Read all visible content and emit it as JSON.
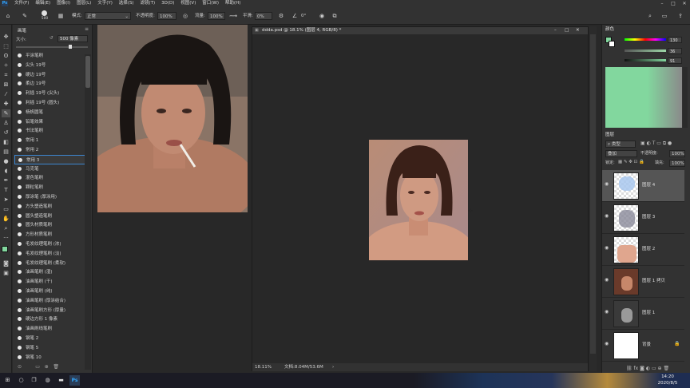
{
  "menubar": {
    "app_icon": "Ps",
    "items": [
      "文件(F)",
      "编辑(E)",
      "图像(I)",
      "图层(L)",
      "文字(Y)",
      "选择(S)",
      "滤镜(T)",
      "3D(D)",
      "视图(V)",
      "窗口(W)",
      "帮助(H)"
    ]
  },
  "optionsbar": {
    "brush_size": "500",
    "mode_label": "模式:",
    "mode_value": "正常",
    "opacity_label": "不透明度:",
    "opacity_value": "100%",
    "flow_label": "流量:",
    "flow_value": "100%",
    "smooth_label": "平滑:",
    "smooth_value": "0%",
    "angle_value": "0°"
  },
  "brushpanel": {
    "title": "画笔",
    "size_label": "大小:",
    "size_value": "500 像素",
    "brushes": [
      {
        "num": "",
        "label": "平涂笔刷"
      },
      {
        "num": "",
        "label": "尖头 19号"
      },
      {
        "num": "",
        "label": "硬边 19号"
      },
      {
        "num": "",
        "label": "柔边 19号"
      },
      {
        "num": "",
        "label": "利插 19号 (尖头)"
      },
      {
        "num": "",
        "label": "利插 19号 (圆头)"
      },
      {
        "num": "",
        "label": "杨帆圆笔"
      },
      {
        "num": "",
        "label": "铅笔效果"
      },
      {
        "num": "",
        "label": "书法笔刷"
      },
      {
        "num": "",
        "label": "常用 1"
      },
      {
        "num": "",
        "label": "常用 2"
      },
      {
        "num": "",
        "label": "常用 3"
      },
      {
        "num": "",
        "label": "马克笔"
      },
      {
        "num": "",
        "label": "混色笔刷"
      },
      {
        "num": "",
        "label": "颗粒笔刷"
      },
      {
        "num": "",
        "label": "厚涂笔 (厚涂用)"
      },
      {
        "num": "",
        "label": "方头塑造笔刷"
      },
      {
        "num": "",
        "label": "圆头塑造笔刷"
      },
      {
        "num": "",
        "label": "圆头材质笔刷"
      },
      {
        "num": "",
        "label": "方形材质笔刷"
      },
      {
        "num": "",
        "label": "毛发纹理笔刷 (浓)"
      },
      {
        "num": "",
        "label": "毛发纹理笔刷 (淡)"
      },
      {
        "num": "",
        "label": "毛发纹理笔刷 (柔软)"
      },
      {
        "num": "",
        "label": "油画笔刷 (湿)"
      },
      {
        "num": "",
        "label": "油画笔刷 (干)"
      },
      {
        "num": "",
        "label": "油画笔刷 (纯)"
      },
      {
        "num": "",
        "label": "油画笔刷 (厚涂结合)"
      },
      {
        "num": "",
        "label": "油画笔刷方形 (厚量)"
      },
      {
        "num": "",
        "label": "硬边方形 1 像素"
      },
      {
        "num": "",
        "label": "油画刷线笔刷"
      },
      {
        "num": "",
        "label": "钢笔 2"
      },
      {
        "num": "",
        "label": "钢笔 5"
      },
      {
        "num": "",
        "label": "钢笔 10"
      }
    ]
  },
  "document": {
    "title": "ddda.psd @ 18.1% (图层 4, RGB/8) *",
    "zoom": "18.11%",
    "doc_info": "文档:8.04M/53.6M"
  },
  "colorpanel": {
    "tab": "颜色",
    "r": "130",
    "g": "36",
    "b": "91"
  },
  "layerspanel": {
    "tab": "图层",
    "kind_label": "类型",
    "blend_value": "叠加",
    "opacity_label": "不透明度:",
    "opacity_value": "100%",
    "lock_label": "锁定:",
    "fill_label": "填充:",
    "fill_value": "100%",
    "layers": [
      {
        "name": "图层 4"
      },
      {
        "name": "图层 3"
      },
      {
        "name": "图层 2"
      },
      {
        "name": "图层 1 拷贝"
      },
      {
        "name": "图层 1"
      },
      {
        "name": "背景"
      }
    ]
  },
  "taskbar": {
    "time": "14:20",
    "date": "2020/8/5"
  }
}
